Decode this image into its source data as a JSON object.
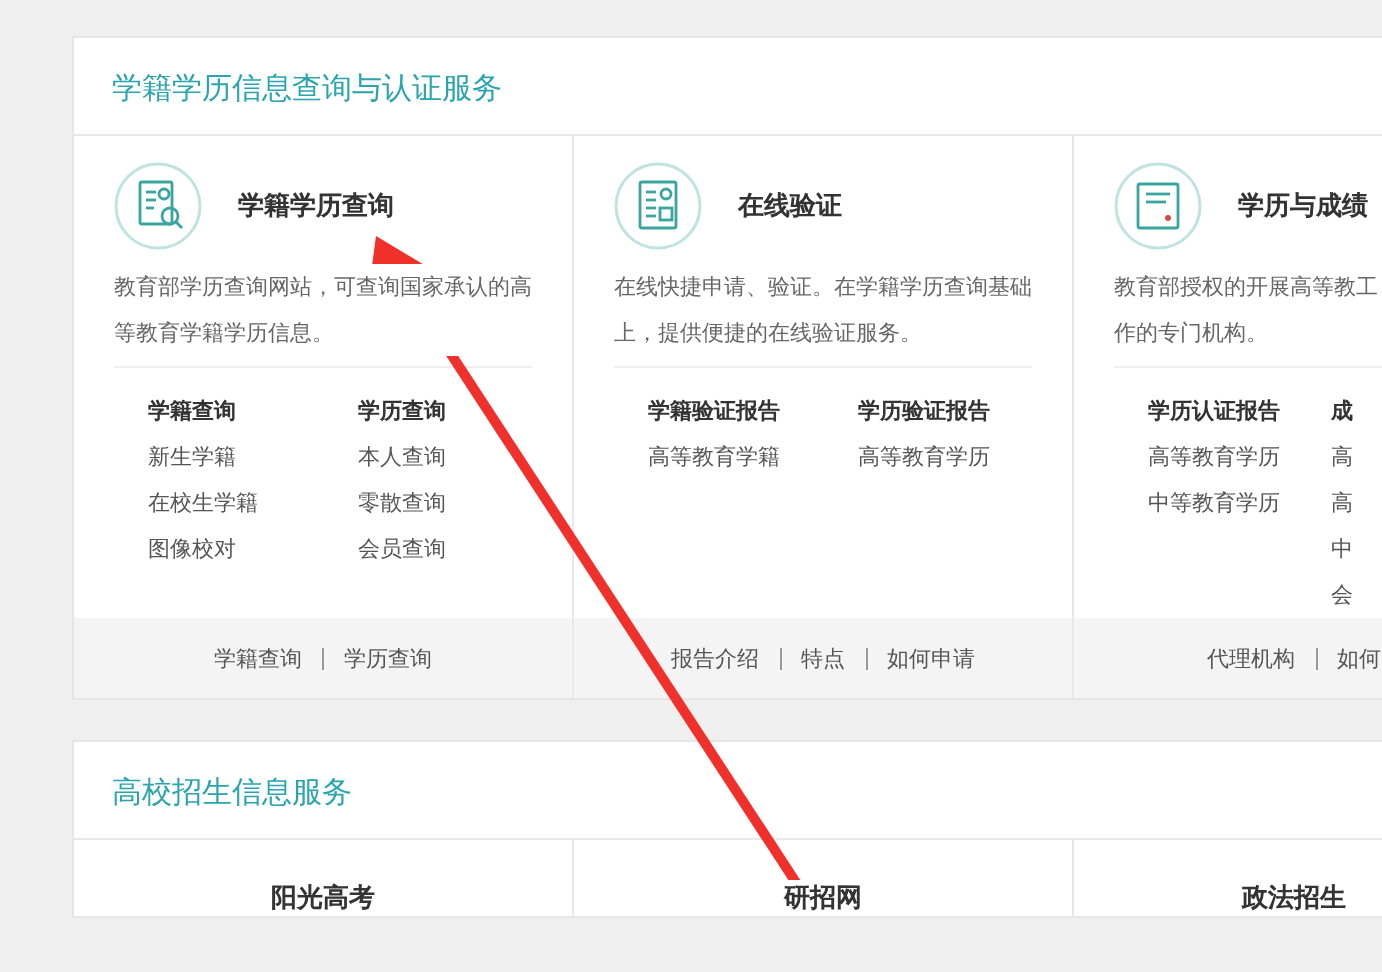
{
  "sections": [
    {
      "title": "学籍学历信息查询与认证服务",
      "services": [
        {
          "kind": "query",
          "title": "学籍学历查询",
          "description": "教育部学历查询网站，可查询国家承认的高等教育学籍学历信息。",
          "link_groups": [
            {
              "heading": "学籍查询",
              "links": [
                "新生学籍",
                "在校生学籍",
                "图像校对"
              ]
            },
            {
              "heading": "学历查询",
              "links": [
                "本人查询",
                "零散查询",
                "会员查询"
              ]
            }
          ],
          "footer_links": [
            "学籍查询",
            "学历查询"
          ]
        },
        {
          "kind": "verify",
          "title": "在线验证",
          "description": "在线快捷申请、验证。在学籍学历查询基础上，提供便捷的在线验证服务。",
          "link_groups": [
            {
              "heading": "学籍验证报告",
              "links": [
                "高等教育学籍"
              ]
            },
            {
              "heading": "学历验证报告",
              "links": [
                "高等教育学历"
              ]
            }
          ],
          "footer_links": [
            "报告介绍",
            "特点",
            "如何申请"
          ]
        },
        {
          "kind": "certificate",
          "title": "学历与成绩",
          "description": "教育部授权的开展高等教工作的专门机构。",
          "link_groups": [
            {
              "heading": "学历认证报告",
              "links": [
                "高等教育学历",
                "中等教育学历"
              ]
            },
            {
              "heading": "成",
              "links": [
                "高",
                "高",
                "中",
                "会"
              ]
            }
          ],
          "footer_links": [
            "代理机构",
            "如何"
          ]
        }
      ]
    },
    {
      "title": "高校招生信息服务",
      "services": [
        {
          "kind": "plain",
          "title": "阳光高考"
        },
        {
          "kind": "plain",
          "title": "研招网"
        },
        {
          "kind": "plain",
          "title": "政法招生"
        }
      ]
    }
  ]
}
